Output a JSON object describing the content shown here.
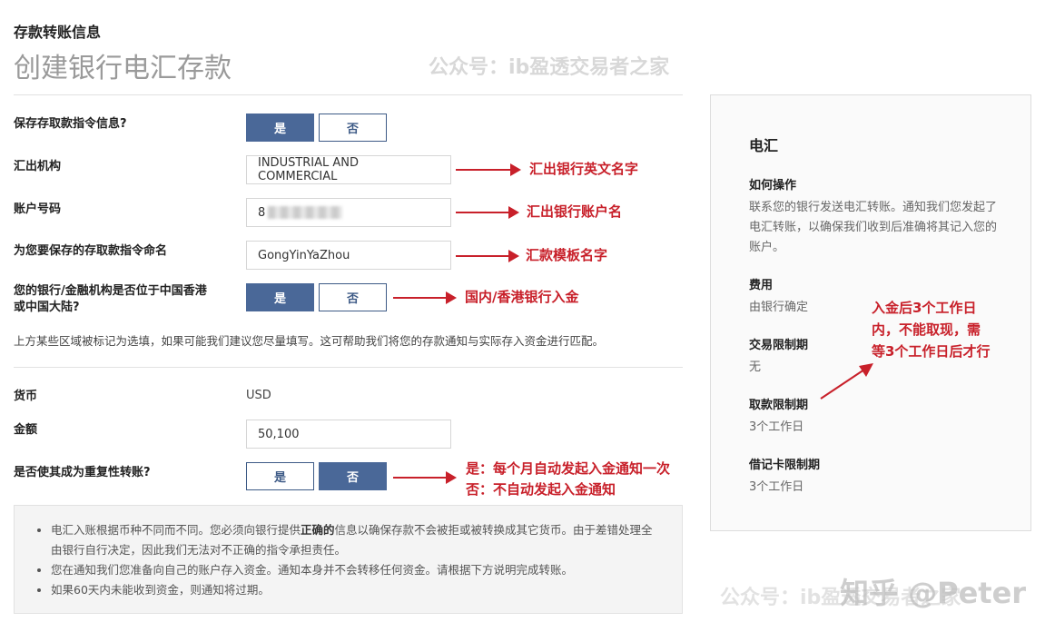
{
  "header": {
    "section_title": "存款转账信息",
    "page_title": "创建银行电汇存款"
  },
  "form": {
    "save_instruction": {
      "label": "保存存取款指令信息?",
      "yes": "是",
      "no": "否",
      "selected": "yes"
    },
    "institution": {
      "label": "汇出机构",
      "value": "INDUSTRIAL AND COMMERCIAL"
    },
    "account": {
      "label": "账户号码",
      "value": "8"
    },
    "instruction_name": {
      "label": "为您要保存的存取款指令命名",
      "value": "GongYinYaZhou"
    },
    "hk_mainland": {
      "label": "您的银行/金融机构是否位于中国香港或中国大陆?",
      "yes": "是",
      "no": "否",
      "selected": "yes"
    },
    "note": "上方某些区域被标记为选填，如果可能我们建议您尽量填写。这可帮助我们将您的存款通知与实际存入资金进行匹配。",
    "currency": {
      "label": "货币",
      "value": "USD"
    },
    "amount": {
      "label": "金额",
      "value": "50,100"
    },
    "recurring": {
      "label": "是否使其成为重复性转账?",
      "yes": "是",
      "no": "否",
      "selected": "no"
    }
  },
  "notice": {
    "item1_a": "电汇入账根据币种不同而不同。您必须向银行提供",
    "item1_bold": "正确的",
    "item1_b": "信息以确保存款不会被拒或被转换成其它货币。由于差错处理全由银行自行决定，因此我们无法对不正确的指令承担责任。",
    "item2": "您在通知我们您准备向自己的账户存入资金。通知本身并不会转移任何资金。请根据下方说明完成转账。",
    "item3": "如果60天内未能收到资金，则通知将过期。"
  },
  "sidebar": {
    "title": "电汇",
    "sections": [
      {
        "heading": "如何操作",
        "text": "联系您的银行发送电汇转账。通知我们您发起了电汇转账，以确保我们收到后准确将其记入您的账户。"
      },
      {
        "heading": "费用",
        "text": "由银行确定"
      },
      {
        "heading": "交易限制期",
        "text": "无"
      },
      {
        "heading": "取款限制期",
        "text": "3个工作日"
      },
      {
        "heading": "借记卡限制期",
        "text": "3个工作日"
      }
    ]
  },
  "annotations": {
    "a1": "汇出银行英文名字",
    "a2": "汇出银行账户名",
    "a3": "汇款模板名字",
    "a4": "国内/香港银行入金",
    "a5_line1": "是：每个月自动发起入金通知一次",
    "a5_line2": "否：不自动发起入金通知",
    "a6_line1": "入金后3个工作日",
    "a6_line2": "内，不能取现，需",
    "a6_line3": "等3个工作日后才行"
  },
  "watermarks": {
    "top": "公众号：ib盈透交易者之家",
    "bottom": "公众号：ib盈透交易者之家",
    "zhihu": "知乎 @Peter"
  },
  "colors": {
    "primary": "#4a6898",
    "annotation": "#c8202a"
  }
}
